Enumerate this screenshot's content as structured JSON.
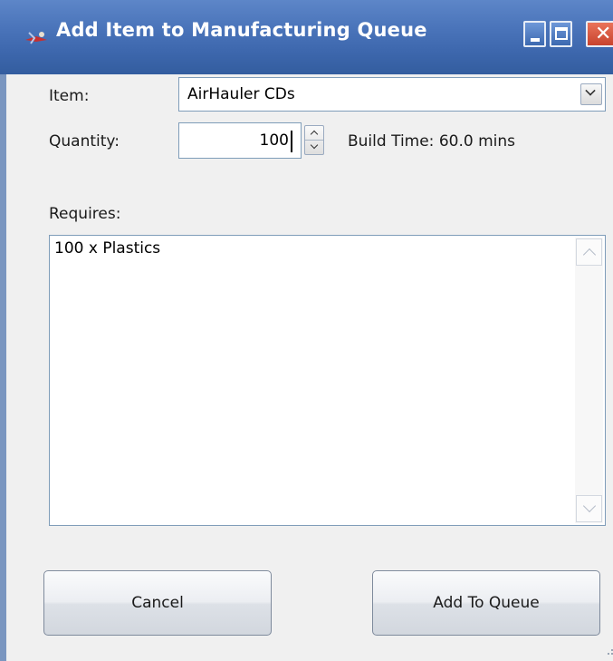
{
  "window": {
    "title": "Add Item to Manufacturing Queue"
  },
  "form": {
    "item_label": "Item:",
    "item_value": "AirHauler CDs",
    "quantity_label": "Quantity:",
    "quantity_value": "100",
    "build_time": "Build Time: 60.0 mins",
    "requires_label": "Requires:",
    "requires_items": [
      "100 x Plastics"
    ]
  },
  "buttons": {
    "cancel": "Cancel",
    "add_to_queue": "Add To Queue"
  },
  "icons": {
    "title_icon": "app-icon",
    "minimize": "minimize-icon",
    "maximize": "maximize-icon",
    "close": "close-icon"
  },
  "colors": {
    "titlebar": "#4a74ba",
    "close_button": "#d2553f",
    "window_bg": "#f0f0f0"
  }
}
